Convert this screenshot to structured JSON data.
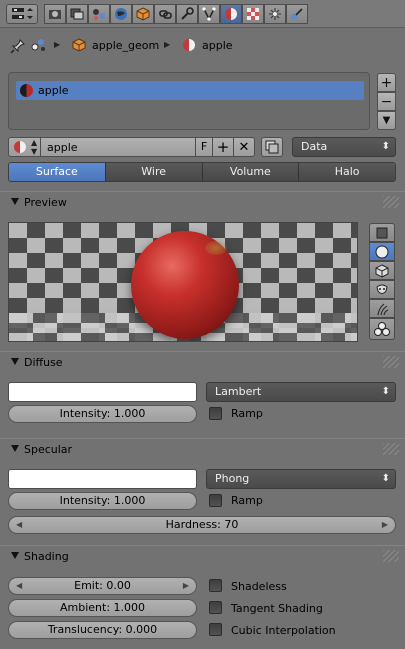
{
  "header": {
    "buttons": [
      {
        "name": "editor-type-icon",
        "active": false
      },
      {
        "name": "render-icon",
        "active": false
      },
      {
        "name": "render-layers-icon",
        "active": false
      },
      {
        "name": "scene-icon",
        "active": false
      },
      {
        "name": "world-icon",
        "active": false
      },
      {
        "name": "object-icon",
        "active": false
      },
      {
        "name": "constraints-icon",
        "active": false
      },
      {
        "name": "modifiers-icon",
        "active": false
      },
      {
        "name": "object-data-icon",
        "active": false
      },
      {
        "name": "material-icon",
        "active": true
      },
      {
        "name": "texture-icon",
        "active": false
      },
      {
        "name": "particles-icon",
        "active": false
      },
      {
        "name": "physics-icon",
        "active": false
      }
    ]
  },
  "breadcrumb": {
    "object": "apple_geom",
    "material": "apple"
  },
  "slots": {
    "items": [
      "apple"
    ]
  },
  "material_selector": {
    "name": "apple",
    "fake_user": "F",
    "link": "Data"
  },
  "tabs": [
    "Surface",
    "Wire",
    "Volume",
    "Halo"
  ],
  "panels": {
    "preview": {
      "title": "Preview"
    },
    "diffuse": {
      "title": "Diffuse",
      "shader": "Lambert",
      "intensity": "Intensity: 1.000",
      "ramp": "Ramp",
      "color": "#ffffff"
    },
    "specular": {
      "title": "Specular",
      "shader": "Phong",
      "intensity": "Intensity: 1.000",
      "ramp": "Ramp",
      "hardness": "Hardness: 70",
      "color": "#ffffff"
    },
    "shading": {
      "title": "Shading",
      "emit": "Emit: 0.00",
      "ambient": "Ambient: 1.000",
      "translucency": "Translucency: 0.000",
      "shadeless": "Shadeless",
      "tangent": "Tangent Shading",
      "cubic": "Cubic Interpolation"
    }
  },
  "colors": {
    "selection": "#5680c2",
    "background": "#727272"
  }
}
